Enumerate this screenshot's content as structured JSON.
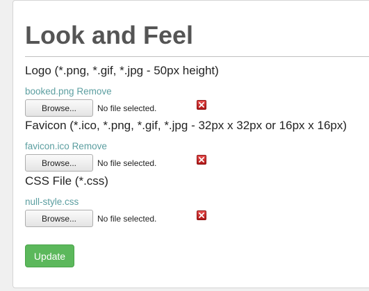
{
  "page": {
    "title": "Look and Feel"
  },
  "sections": [
    {
      "heading": "Logo (*.png, *.gif, *.jpg - 50px height)",
      "file_name": "booked.png",
      "remove_label": "Remove",
      "browse_label": "Browse...",
      "file_status": "No file selected.",
      "remove_icon": "close-icon"
    },
    {
      "heading": "Favicon (*.ico, *.png, *.gif, *.jpg - 32px x 32px or 16px x 16px)",
      "file_name": "favicon.ico",
      "remove_label": "Remove",
      "browse_label": "Browse...",
      "file_status": "No file selected.",
      "remove_icon": "close-icon"
    },
    {
      "heading": "CSS File (*.css)",
      "file_name": "null-style.css",
      "browse_label": "Browse...",
      "file_status": "No file selected.",
      "remove_icon": "close-icon"
    }
  ],
  "actions": {
    "update_label": "Update"
  },
  "colors": {
    "link": "#5b9ea0",
    "update_button": "#5cb85c",
    "remove_icon": "#c62828"
  }
}
